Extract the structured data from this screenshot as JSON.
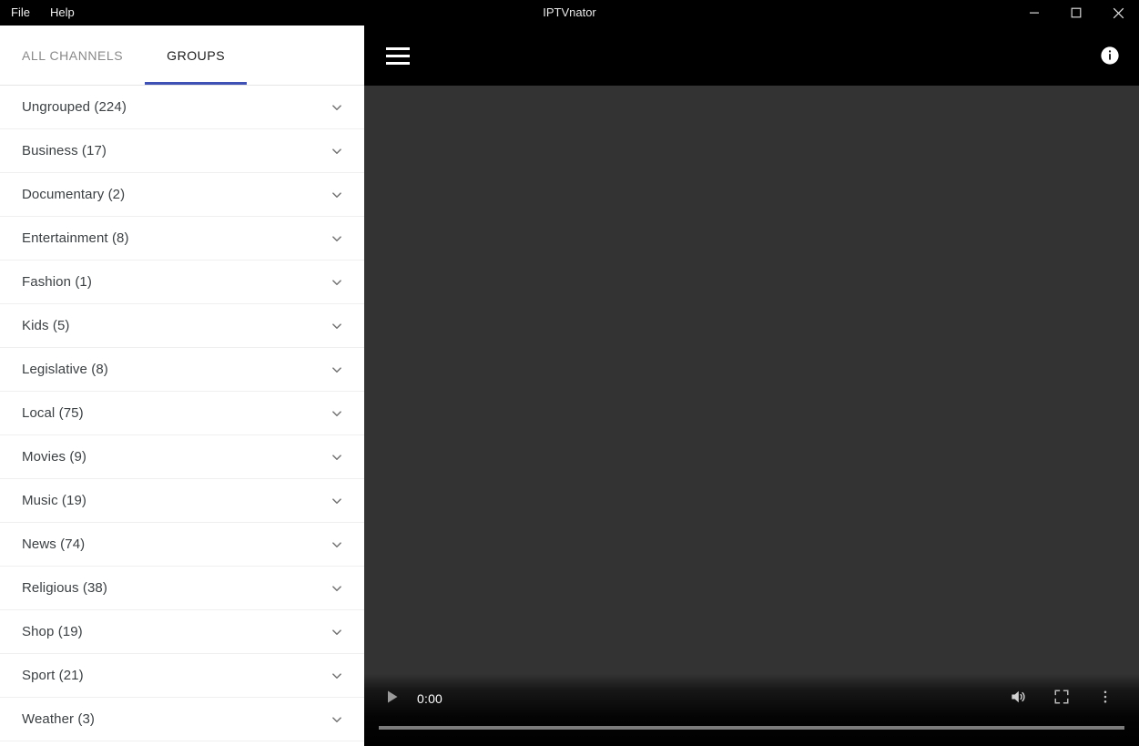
{
  "titlebar": {
    "menus": [
      {
        "label": "File"
      },
      {
        "label": "Help"
      }
    ],
    "app_title": "IPTVnator",
    "window_controls": [
      {
        "name": "minimize",
        "label": "Minimize"
      },
      {
        "name": "maximize",
        "label": "Maximize"
      },
      {
        "name": "close",
        "label": "Close"
      }
    ]
  },
  "sidebar": {
    "tabs": [
      {
        "label": "ALL CHANNELS",
        "active": false
      },
      {
        "label": "GROUPS",
        "active": true
      }
    ],
    "active_tab_color": "#3f51b5",
    "groups": [
      {
        "name": "Ungrouped",
        "count": 224,
        "label": "Ungrouped (224)"
      },
      {
        "name": "Business",
        "count": 17,
        "label": "Business (17)"
      },
      {
        "name": "Documentary",
        "count": 2,
        "label": "Documentary (2)"
      },
      {
        "name": "Entertainment",
        "count": 8,
        "label": "Entertainment (8)"
      },
      {
        "name": "Fashion",
        "count": 1,
        "label": "Fashion (1)"
      },
      {
        "name": "Kids",
        "count": 5,
        "label": "Kids (5)"
      },
      {
        "name": "Legislative",
        "count": 8,
        "label": "Legislative (8)"
      },
      {
        "name": "Local",
        "count": 75,
        "label": "Local (75)"
      },
      {
        "name": "Movies",
        "count": 9,
        "label": "Movies (9)"
      },
      {
        "name": "Music",
        "count": 19,
        "label": "Music (19)"
      },
      {
        "name": "News",
        "count": 74,
        "label": "News (74)"
      },
      {
        "name": "Religious",
        "count": 38,
        "label": "Religious (38)"
      },
      {
        "name": "Shop",
        "count": 19,
        "label": "Shop (19)"
      },
      {
        "name": "Sport",
        "count": 21,
        "label": "Sport (21)"
      },
      {
        "name": "Weather",
        "count": 3,
        "label": "Weather (3)"
      }
    ],
    "expand_icon": "chevron-down-icon"
  },
  "main": {
    "toolbar": {
      "menu_icon": "hamburger-menu-icon",
      "info_icon": "info-circle-icon"
    },
    "video": {
      "background_color": "#333333",
      "current_time": "0:00",
      "progress_percent": 0,
      "controls": [
        {
          "name": "play",
          "icon": "play-icon"
        },
        {
          "name": "mute",
          "icon": "volume-icon"
        },
        {
          "name": "fullscreen",
          "icon": "fullscreen-icon"
        },
        {
          "name": "more-options",
          "icon": "kebab-menu-icon"
        }
      ]
    }
  }
}
